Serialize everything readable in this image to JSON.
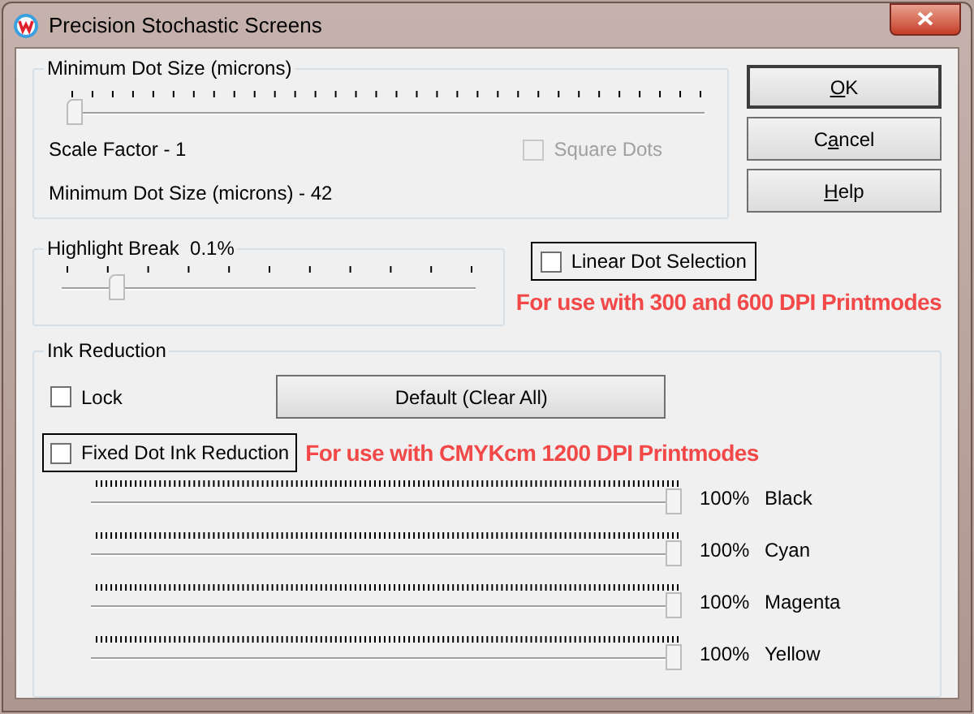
{
  "window": {
    "title": "Precision Stochastic Screens"
  },
  "min_dot_group": {
    "label": "Minimum Dot Size (microns)",
    "slider": {
      "level": 0
    },
    "scale_factor": "Scale Factor - 1",
    "square_dots": {
      "label": "Square Dots",
      "checked": false,
      "disabled": true
    },
    "min_dot_readout": "Minimum Dot Size (microns) - 42"
  },
  "buttons": [
    {
      "accel": "O",
      "rest": "K",
      "default": true
    },
    {
      "prefix": "C",
      "accel": "a",
      "rest": "ncel",
      "default": false
    },
    {
      "accel": "H",
      "rest": "elp",
      "default": false
    }
  ],
  "highlight_group": {
    "label": "Highlight Break  0.1%",
    "slider": {
      "level": 0.12
    }
  },
  "linear_dot": {
    "label": "Linear Dot Selection",
    "checked": false
  },
  "note_300_600": "For use with 300 and 600 DPI Printmodes",
  "ink_group": {
    "label": "Ink Reduction",
    "lock": {
      "label": "Lock",
      "checked": false
    },
    "default_button": "Default (Clear All)",
    "fixed_dot": {
      "label": "Fixed Dot Ink Reduction",
      "checked": false
    },
    "note_cmyk": "For use with CMYKcm 1200 DPI Printmodes",
    "channels": [
      {
        "name": "Black",
        "level": 1,
        "reading": "100%"
      },
      {
        "name": "Cyan",
        "level": 1,
        "reading": "100%"
      },
      {
        "name": "Magenta",
        "level": 1,
        "reading": "100%"
      },
      {
        "name": "Yellow",
        "level": 1,
        "reading": "100%"
      }
    ]
  }
}
